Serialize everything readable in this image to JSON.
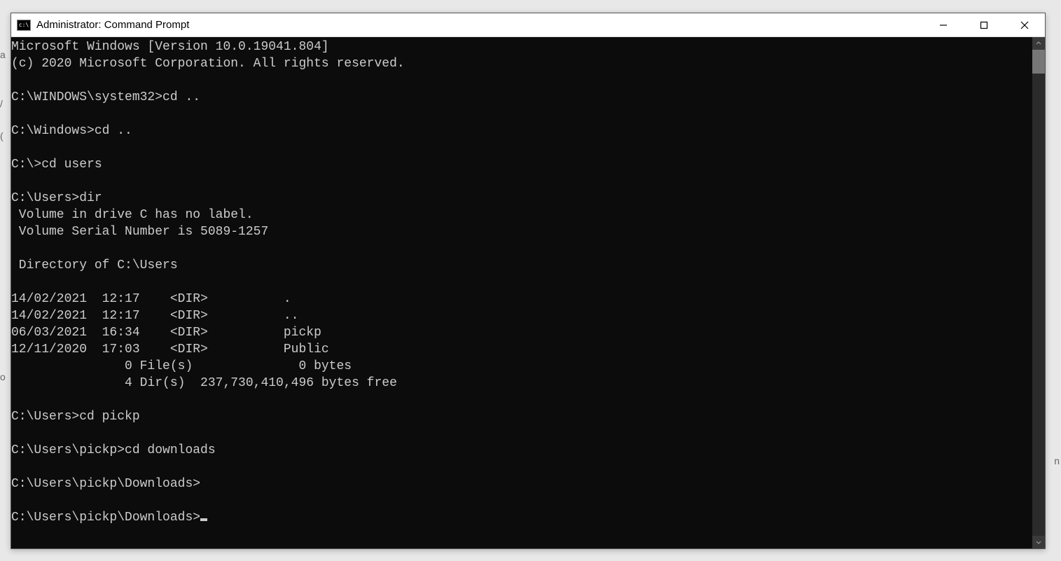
{
  "window": {
    "title": "Administrator: Command Prompt"
  },
  "terminal": {
    "lines": [
      "Microsoft Windows [Version 10.0.19041.804]",
      "(c) 2020 Microsoft Corporation. All rights reserved.",
      "",
      "C:\\WINDOWS\\system32>cd ..",
      "",
      "C:\\Windows>cd ..",
      "",
      "C:\\>cd users",
      "",
      "C:\\Users>dir",
      " Volume in drive C has no label.",
      " Volume Serial Number is 5089-1257",
      "",
      " Directory of C:\\Users",
      "",
      "14/02/2021  12:17    <DIR>          .",
      "14/02/2021  12:17    <DIR>          ..",
      "06/03/2021  16:34    <DIR>          pickp",
      "12/11/2020  17:03    <DIR>          Public",
      "               0 File(s)              0 bytes",
      "               4 Dir(s)  237,730,410,496 bytes free",
      "",
      "C:\\Users>cd pickp",
      "",
      "C:\\Users\\pickp>cd downloads",
      "",
      "C:\\Users\\pickp\\Downloads>",
      ""
    ],
    "current_prompt": "C:\\Users\\pickp\\Downloads>"
  }
}
